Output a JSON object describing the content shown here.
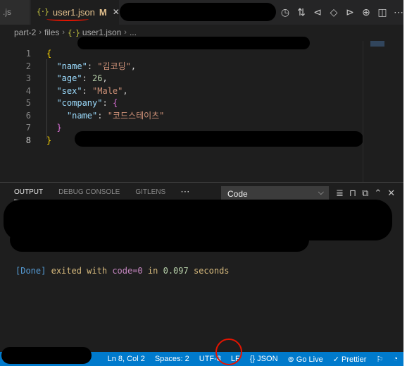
{
  "tabs": {
    "previous_tab": ".js",
    "active": {
      "icon": "json-braces-icon",
      "label": "user1.json",
      "status": "M"
    }
  },
  "tab_actions": [
    "history-icon",
    "compare-icon",
    "go-back-icon",
    "go-around-icon",
    "go-forward-icon",
    "git-lens-icon",
    "split-editor-icon",
    "more-actions-icon"
  ],
  "breadcrumb": {
    "segments": [
      "part-2",
      "files",
      "user1.json",
      "..."
    ]
  },
  "editor": {
    "line_numbers": [
      "1",
      "2",
      "3",
      "4",
      "5",
      "6",
      "7",
      "8"
    ],
    "lines": [
      {
        "tokens": [
          {
            "t": "{",
            "c": "br1"
          }
        ]
      },
      {
        "tokens": [
          {
            "t": "  "
          },
          {
            "t": "\"name\"",
            "c": "key"
          },
          {
            "t": ": "
          },
          {
            "t": "\"김코딩\"",
            "c": "str"
          },
          {
            "t": ","
          }
        ]
      },
      {
        "tokens": [
          {
            "t": "  "
          },
          {
            "t": "\"age\"",
            "c": "key"
          },
          {
            "t": ": "
          },
          {
            "t": "26",
            "c": "num"
          },
          {
            "t": ","
          }
        ]
      },
      {
        "tokens": [
          {
            "t": "  "
          },
          {
            "t": "\"sex\"",
            "c": "key"
          },
          {
            "t": ": "
          },
          {
            "t": "\"Male\"",
            "c": "str"
          },
          {
            "t": ","
          }
        ]
      },
      {
        "tokens": [
          {
            "t": "  "
          },
          {
            "t": "\"company\"",
            "c": "key"
          },
          {
            "t": ": "
          },
          {
            "t": "{",
            "c": "br2"
          }
        ]
      },
      {
        "tokens": [
          {
            "t": "    "
          },
          {
            "t": "\"name\"",
            "c": "key"
          },
          {
            "t": ": "
          },
          {
            "t": "\"코드스테이츠\"",
            "c": "str"
          }
        ]
      },
      {
        "tokens": [
          {
            "t": "  "
          },
          {
            "t": "}",
            "c": "br2"
          }
        ]
      },
      {
        "tokens": [
          {
            "t": "}",
            "c": "br1"
          }
        ]
      }
    ],
    "current_line": "8"
  },
  "panel": {
    "tabs": [
      "OUTPUT",
      "DEBUG CONSOLE",
      "GITLENS"
    ],
    "active_tab": "OUTPUT",
    "more_label": "···",
    "output_channel": "Code",
    "actions": [
      "filter-icon",
      "lock-icon",
      "copy-icon",
      "chevron-up-icon",
      "close-icon"
    ],
    "output": {
      "done_tag": "[Done]",
      "exited_with": "exited with",
      "code_text": "code=0",
      "in_word": "in",
      "duration": "0.097",
      "seconds_word": "seconds"
    }
  },
  "statusbar": {
    "cursor_position": "Ln 8, Col 2",
    "indentation": "Spaces: 2",
    "encoding": "UTF-8",
    "eol": "LF",
    "language": "{} JSON",
    "go_live": "Go Live",
    "prettier": "Prettier"
  },
  "colors": {
    "editor_bg": "#1e1e1e",
    "statusbar_bg": "#007acc",
    "annotation_red": "#e51400"
  }
}
